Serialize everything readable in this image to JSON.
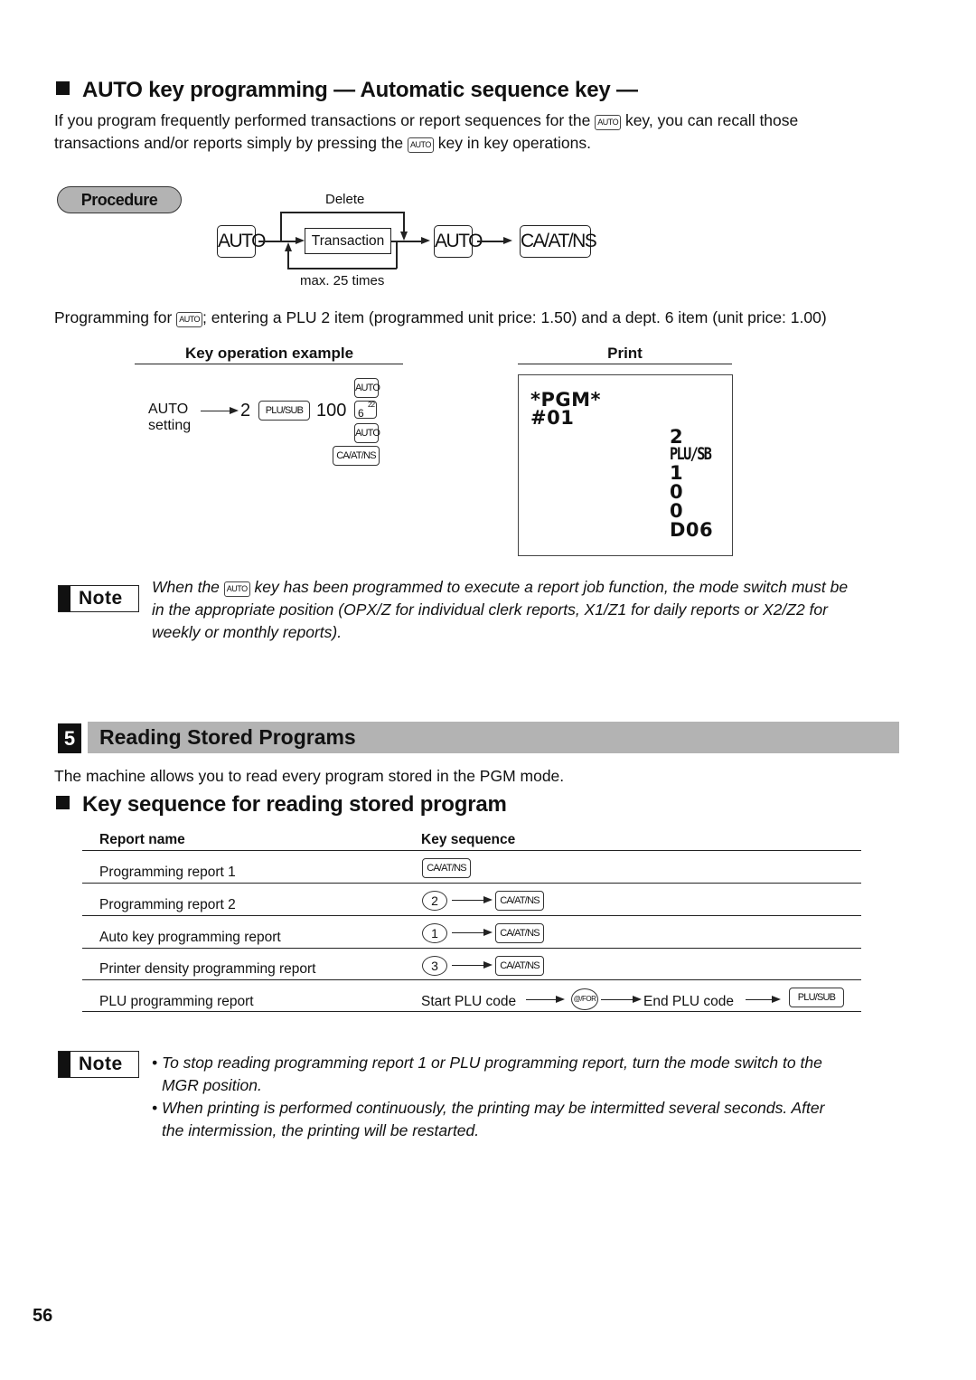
{
  "auto_section": {
    "heading": "AUTO key programming — Automatic sequence key —",
    "intro": {
      "line1_before": "If you program frequently performed transactions or report sequences for the",
      "line1_after": "key, you can recall those",
      "line2_before": "transactions and/or reports simply by pressing the",
      "line2_after": "key in key operations.",
      "inline_key": "AUTO"
    },
    "procedure": {
      "label": "Procedure",
      "key_auto": "AUTO",
      "transaction": "Transaction",
      "delete_label": "Delete",
      "loop_label": "max. 25 times",
      "key_auto_2": "AUTO",
      "key_finalize": "CA/AT/NS"
    },
    "example_caption": {
      "before": "Programming for",
      "key": "AUTO",
      "after": "; entering a PLU 2 item (programmed unit price: 1.50) and a dept. 6 item (unit price: 1.00)"
    },
    "key_operation": {
      "heading": "Key operation example",
      "start_label_1": "AUTO",
      "start_label_2": "setting",
      "value_1": "2",
      "key_plu": "PLU/SUB",
      "value_2": "100",
      "stack": [
        "AUTO",
        "6",
        "AUTO",
        "CA/AT/NS"
      ],
      "dept_superscript": "22"
    },
    "print": {
      "heading": "Print",
      "lines_left": [
        "*PGM*",
        "#01"
      ],
      "lines_right": [
        "2",
        "PLU/SB",
        "1",
        "0",
        "0",
        "D06"
      ]
    },
    "note": {
      "badge": "Note",
      "before": "When the",
      "key": "AUTO",
      "after_line1": "key has been programmed to execute a report job function, the mode switch must be",
      "line2": "in the appropriate position (OPX/Z for individual clerk reports, X1/Z1 for daily reports or X2/Z2 for",
      "line3": "weekly or monthly reports)."
    }
  },
  "reading_section": {
    "number": "5",
    "title": "Reading Stored Programs",
    "intro": "The machine allows you to read every program stored in the PGM mode.",
    "subheading": "Key sequence for reading stored program",
    "table": {
      "columns": [
        "Report name",
        "Key sequence"
      ],
      "rows": [
        {
          "name": "Programming report 1",
          "sequence": {
            "circle": null,
            "key": "CA/AT/NS"
          }
        },
        {
          "name": "Programming report 2",
          "sequence": {
            "circle": "2",
            "key": "CA/AT/NS"
          }
        },
        {
          "name": "Auto key programming report",
          "sequence": {
            "circle": "1",
            "key": "CA/AT/NS"
          }
        },
        {
          "name": "Printer density programming report",
          "sequence": {
            "circle": "3",
            "key": "CA/AT/NS"
          }
        },
        {
          "name": "PLU programming report",
          "sequence": {
            "start": "Start PLU code",
            "circle_key": "@/FOR",
            "end": "End PLU code",
            "key": "PLU/SUB"
          }
        }
      ]
    },
    "note": {
      "badge": "Note",
      "bullets": [
        {
          "line1": "• To stop reading programming report 1 or PLU programming report, turn the mode switch to the",
          "line2": "MGR position."
        },
        {
          "line1": "• When printing is performed continuously, the printing may be intermitted several seconds.  After",
          "line2": "the intermission, the printing will be restarted."
        }
      ]
    }
  },
  "page_number": "56"
}
